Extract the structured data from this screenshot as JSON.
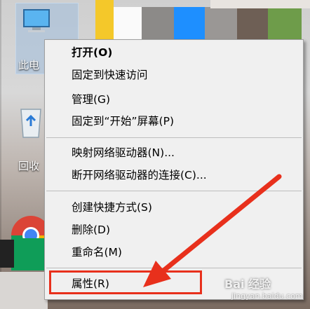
{
  "desktop": {
    "icons": [
      {
        "label": "此电"
      },
      {
        "label": "回收"
      }
    ]
  },
  "menu": {
    "items": [
      {
        "label": "打开(O)",
        "bold": true
      },
      {
        "label": "固定到快速访问"
      },
      {
        "label": "管理(G)"
      },
      {
        "label": "固定到“开始”屏幕(P)"
      },
      {
        "label": "映射网络驱动器(N)..."
      },
      {
        "label": "断开网络驱动器的连接(C)..."
      },
      {
        "label": "创建快捷方式(S)"
      },
      {
        "label": "删除(D)"
      },
      {
        "label": "重命名(M)"
      },
      {
        "label": "属性(R)"
      }
    ]
  },
  "annotation": {
    "highlight_color": "#e8301c",
    "arrow_color": "#e8301c",
    "highlighted_item": "属性(R)"
  },
  "watermark": {
    "text": "Bai 经验",
    "sub": "jingyan.baidu.com"
  }
}
